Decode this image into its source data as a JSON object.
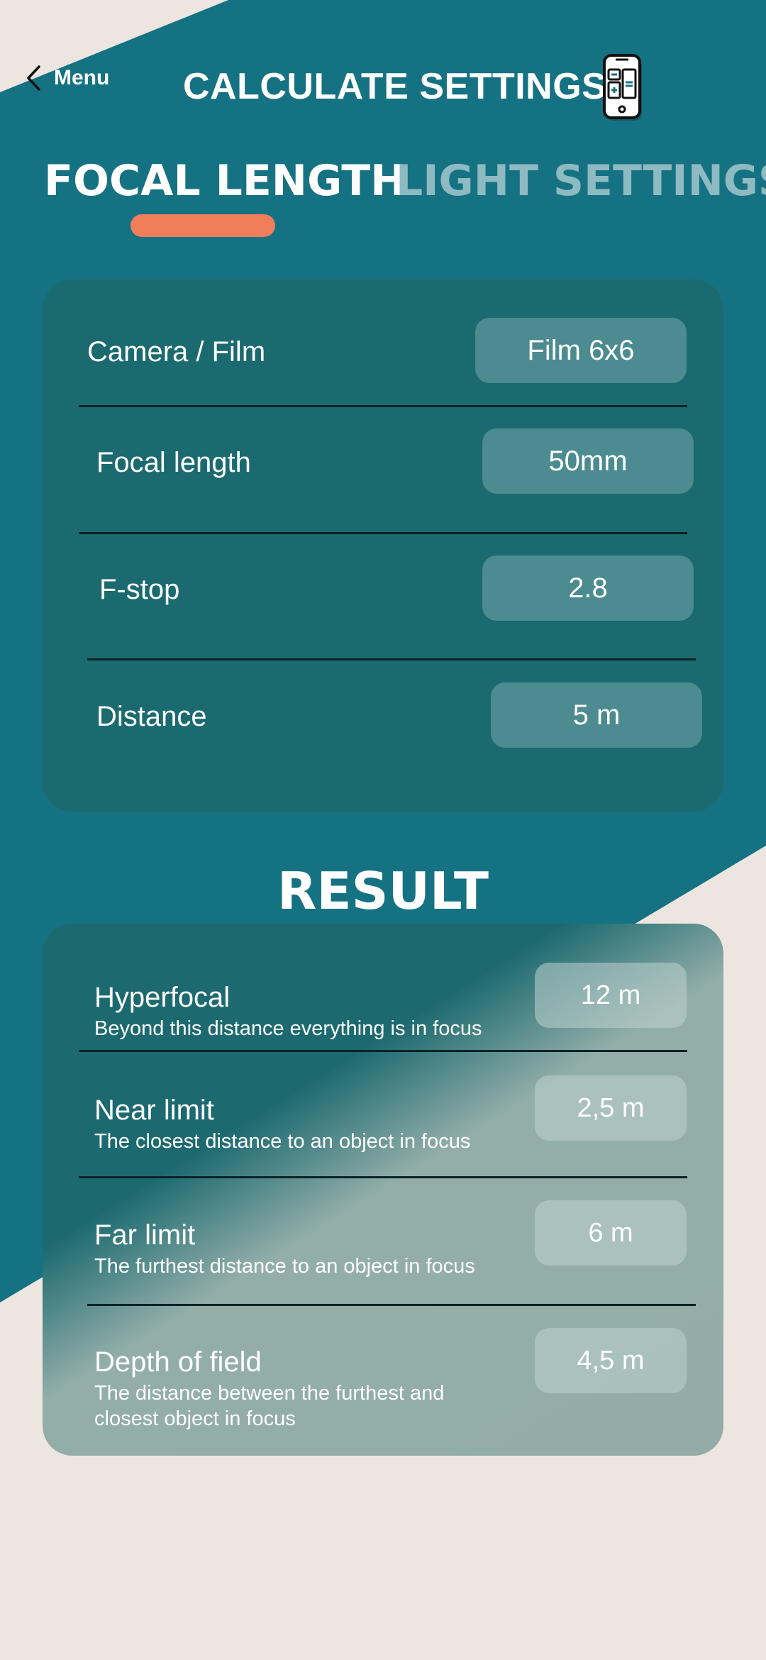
{
  "header": {
    "menu_label": "Menu",
    "title": "CALCULATE SETTINGS"
  },
  "tabs": [
    {
      "label": "FOCAL LENGTH",
      "active": true
    },
    {
      "label": "LIGHT SETTINGS",
      "active": false
    }
  ],
  "settings": [
    {
      "label": "Camera / Film",
      "value": "Film 6x6"
    },
    {
      "label": "Focal length",
      "value": "50mm"
    },
    {
      "label": "F-stop",
      "value": "2.8"
    },
    {
      "label": "Distance",
      "value": "5 m"
    }
  ],
  "result": {
    "title": "RESULT",
    "items": [
      {
        "label": "Hyperfocal",
        "description": "Beyond this distance everything is in focus",
        "value": "12 m"
      },
      {
        "label": "Near limit",
        "description": "The closest distance to an object in focus",
        "value": "2,5 m"
      },
      {
        "label": "Far limit",
        "description": "The furthest distance to an object in focus",
        "value": "6 m"
      },
      {
        "label": "Depth of field",
        "description": "The distance between the furthest and closest object in focus",
        "value": "4,5 m"
      }
    ]
  },
  "colors": {
    "background": "#ede6e0",
    "teal": "#157282",
    "card": "#1b6a70",
    "accent": "#f07e5b",
    "inactive_tab": "#8ebac2"
  },
  "icons": [
    "chevron-left-icon",
    "calculator-phone-icon"
  ]
}
